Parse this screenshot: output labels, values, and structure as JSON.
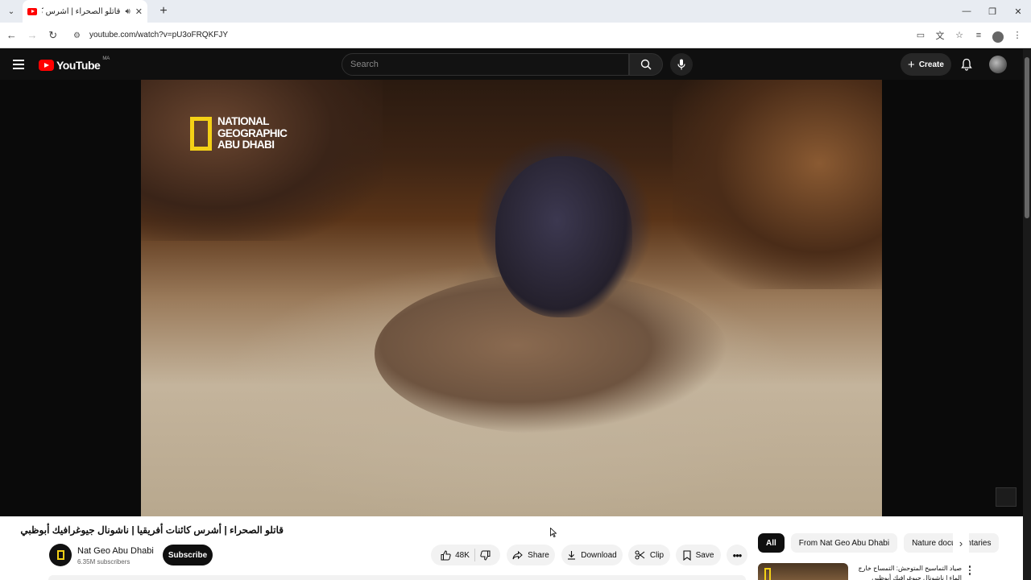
{
  "browser": {
    "tab_title": "قاتلو الصحراء | أشرس كائنات",
    "url": "youtube.com/watch?v=pU3oFRQKFJY"
  },
  "header": {
    "logo_text": "YouTube",
    "region": "MA",
    "search_placeholder": "Search",
    "create_label": "Create"
  },
  "video": {
    "watermark_lines": [
      "NATIONAL",
      "GEOGRAPHIC",
      "ABU DHABI"
    ],
    "title": "قاتلو الصحراء | أشرس كائنات أفريقيا | ناشونال جيوغرافيك أبوظبي"
  },
  "channel": {
    "name": "Nat Geo Abu Dhabi",
    "subscribers": "6.35M subscribers",
    "subscribe_label": "Subscribe"
  },
  "actions": {
    "likes": "48K",
    "share": "Share",
    "download": "Download",
    "clip": "Clip",
    "save": "Save"
  },
  "chips": [
    "All",
    "From Nat Geo Abu Dhabi",
    "Nature documentaries"
  ],
  "recommendation": {
    "title": "صياد التماسيح المتوحش: التمساح خارج الماء | ناشونال جيوغرافيك أبوظبي"
  },
  "colors": {
    "brand_red": "#ff0000",
    "natgeo_yellow": "#f4d116",
    "dark_bg": "#0f0f0f"
  }
}
